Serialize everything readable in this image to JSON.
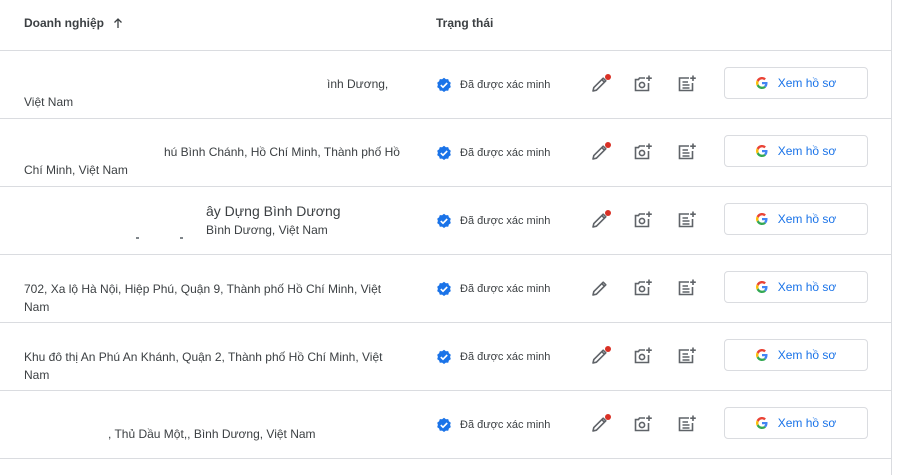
{
  "header": {
    "business_label": "Doanh nghiệp",
    "status_label": "Trạng thái",
    "sort_icon": "arrow-up-icon"
  },
  "rows": [
    {
      "address_lines": [
        "ình Dương,",
        "Việt Nam"
      ],
      "status": "Đã được xác minh",
      "edit_has_dot": true,
      "button_label": "Xem hồ sơ"
    },
    {
      "address_lines": [
        "hú Bình Chánh, Hồ Chí Minh, Thành phố Hồ",
        "Chí Minh, Việt Nam"
      ],
      "status": "Đã được xác minh",
      "edit_has_dot": true,
      "button_label": "Xem hồ sơ"
    },
    {
      "address_lines": [
        "ây Dựng Bình Dương",
        "Bình Dương, Việt Nam"
      ],
      "status": "Đã được xác minh",
      "edit_has_dot": true,
      "button_label": "Xem hồ sơ"
    },
    {
      "address_lines": [
        "702, Xa lộ Hà Nội, Hiệp Phú, Quận 9, Thành phố Hồ Chí Minh, Việt",
        "Nam"
      ],
      "status": "Đã được xác minh",
      "edit_has_dot": false,
      "button_label": "Xem hồ sơ"
    },
    {
      "address_lines": [
        "Khu đô thị An Phú An Khánh, Quận 2, Thành phố Hồ Chí Minh, Việt",
        "Nam"
      ],
      "status": "Đã được xác minh",
      "edit_has_dot": true,
      "button_label": "Xem hồ sơ"
    },
    {
      "address_lines": [
        ", Thủ Dầu Một,, Bình Dương, Việt Nam"
      ],
      "status": "Đã được xác minh",
      "edit_has_dot": true,
      "button_label": "Xem hồ sơ"
    }
  ],
  "icons": {
    "verified": "verified-badge-icon",
    "edit": "pencil-icon",
    "add_photo": "add-photo-icon",
    "add_post": "add-post-icon",
    "google": "google-g-icon"
  },
  "colors": {
    "accent": "#1a73e8",
    "verified": "#1a73e8",
    "notification_dot": "#d93025",
    "divider": "#dadce0"
  }
}
